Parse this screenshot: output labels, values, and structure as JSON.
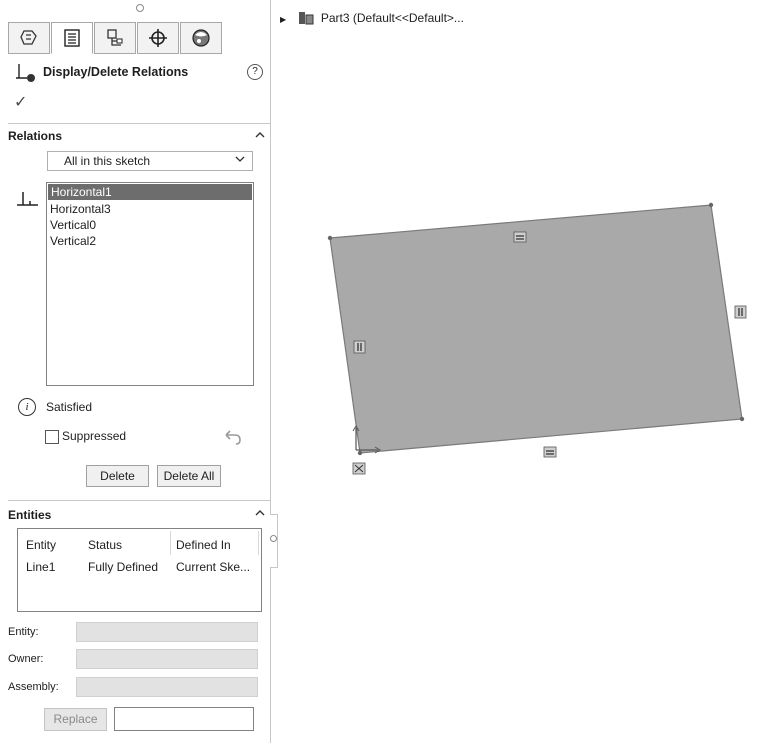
{
  "property_manager": {
    "tabs": [
      "featuremanager-icon",
      "propertymanager-icon",
      "configurationmanager-icon",
      "dimxpert-icon",
      "display-manager-icon"
    ],
    "title": "Display/Delete Relations",
    "help": "?",
    "ok": "✓"
  },
  "relations": {
    "group_title": "Relations",
    "filter": "All in this sketch",
    "items": [
      "Horizontal1",
      "Horizontal3",
      "Vertical0",
      "Vertical2"
    ],
    "selected_index": 0,
    "status": "Satisfied",
    "suppressed_label": "Suppressed",
    "suppressed_checked": false,
    "delete_label": "Delete",
    "delete_all_label": "Delete All"
  },
  "entities": {
    "group_title": "Entities",
    "columns": [
      "Entity",
      "Status",
      "Defined In"
    ],
    "rows": [
      [
        "Line1",
        "Fully Defined",
        "Current Ske..."
      ]
    ],
    "entity_label": "Entity:",
    "owner_label": "Owner:",
    "assembly_label": "Assembly:",
    "entity_value": "",
    "owner_value": "",
    "assembly_value": "",
    "replace_label": "Replace",
    "replace_value": ""
  },
  "tree": {
    "part_label": "Part3  (Default<<Default>..."
  },
  "graphics": {
    "rect_fill": "#a9a9a9",
    "rect_stroke": "#7a7a7a",
    "horizontal_glyph": "═",
    "vertical_glyph": "‖"
  }
}
